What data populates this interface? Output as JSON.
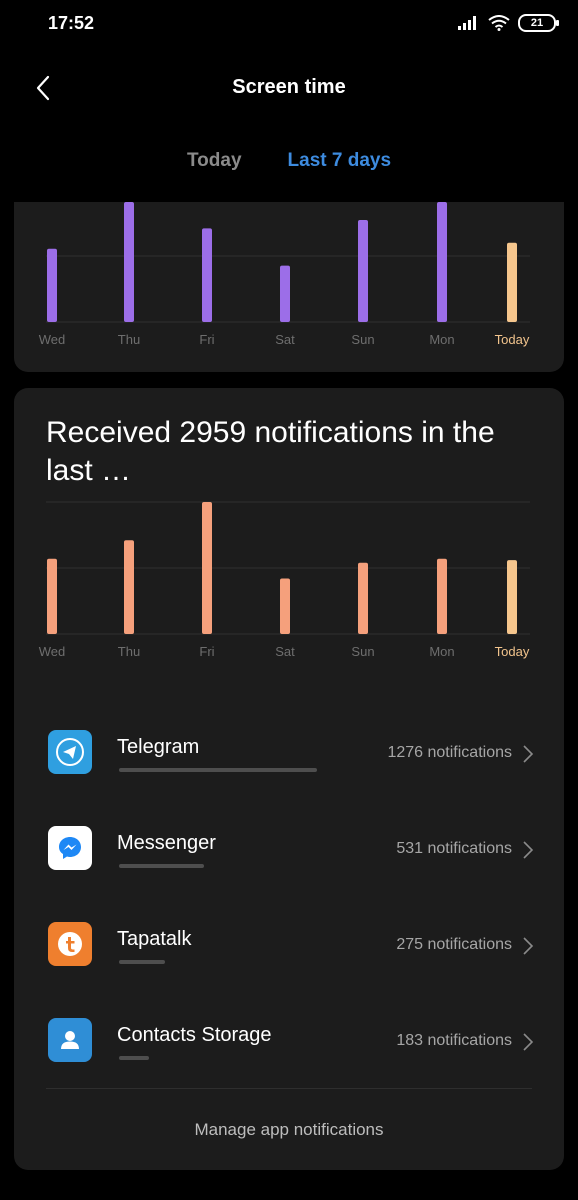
{
  "status_bar": {
    "time": "17:52",
    "battery": "21"
  },
  "header": {
    "title": "Screen time"
  },
  "tabs": [
    {
      "label": "Today",
      "active": false
    },
    {
      "label": "Last 7 days",
      "active": true
    }
  ],
  "colors": {
    "usage_bar": "#9c6ee8",
    "notif_bar": "#f5a07c",
    "today_bar": "#f6c68d",
    "accent": "#3d8bdf"
  },
  "chart_data": [
    {
      "type": "bar",
      "categories": [
        "Wed",
        "Thu",
        "Fri",
        "Sat",
        "Sun",
        "Mon",
        "Today"
      ],
      "values": [
        0.61,
        1.0,
        0.78,
        0.47,
        0.85,
        1.0,
        0.66
      ],
      "highlight": "Today"
    },
    {
      "type": "bar",
      "title": "Received 2959 notifications in the last …",
      "categories": [
        "Wed",
        "Thu",
        "Fri",
        "Sat",
        "Sun",
        "Mon",
        "Today"
      ],
      "values": [
        0.57,
        0.71,
        1.0,
        0.42,
        0.54,
        0.57,
        0.56
      ],
      "highlight": "Today"
    }
  ],
  "apps": [
    {
      "name": "Telegram",
      "count": "1276 notifications",
      "share": 1.0,
      "icon": "telegram-icon",
      "color": "#2f9fe0"
    },
    {
      "name": "Messenger",
      "count": "531 notifications",
      "share": 0.43,
      "icon": "messenger-icon",
      "color": "#ffffff"
    },
    {
      "name": "Tapatalk",
      "count": "275 notifications",
      "share": 0.23,
      "icon": "tapatalk-icon",
      "color": "#ef7f2e"
    },
    {
      "name": "Contacts Storage",
      "count": "183 notifications",
      "share": 0.15,
      "icon": "contacts-icon",
      "color": "#2f8ed6"
    }
  ],
  "footer": {
    "manage_label": "Manage app notifications"
  }
}
